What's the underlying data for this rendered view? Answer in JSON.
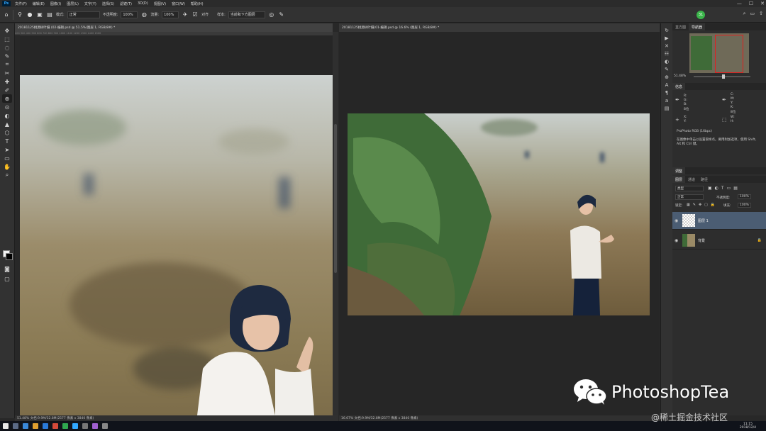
{
  "menubar": {
    "logo": "Ps",
    "items": [
      "文件(F)",
      "编辑(E)",
      "图像(I)",
      "图层(L)",
      "文字(Y)",
      "选择(S)",
      "滤镜(T)",
      "3D(D)",
      "视图(V)",
      "窗口(W)",
      "帮助(H)"
    ],
    "window_controls": [
      "—",
      "☐",
      "✕"
    ]
  },
  "options": {
    "mode_label": "模式:",
    "mode_value": "正常",
    "opacity_label": "不透明度:",
    "opacity_value": "100%",
    "flow_label": "流量:",
    "flow_value": "100%",
    "align_label": "对齐",
    "sample_label": "样本:",
    "sample_value": "当前和下方图层",
    "avatar": "31"
  },
  "tools": [
    "✥",
    "⬚",
    "◌",
    "✎",
    "⌗",
    "✂",
    "✚",
    "✐",
    "⊕",
    "⊙",
    "◐",
    "▲",
    "⬡",
    "T",
    "➤",
    "▭",
    "✋",
    "⌕"
  ],
  "doc_left": {
    "tab": "20181125桃源树叶摄 (02-编辑.psd @ 51.5%(图层 1, RGB/8#) *",
    "status": "51.48%  文档:9.9M/32.8M(2577 像素 x 3840 像素)",
    "ruler": "200    300    400    500    600    700    800    900    1000    1100    1200    1300    1400    1500"
  },
  "doc_right": {
    "tab": "20181125桃源树叶摄(01-编辑.psd @ 16.6% (图层 1, RGB/8#) *",
    "status": "16.67%  文档:9.9M/32.8M(2577 像素 x 3840 像素)"
  },
  "navigator": {
    "tabs": [
      "直方图",
      "导航器"
    ],
    "zoom": "51.48%"
  },
  "info": {
    "tab": "信息",
    "rgb_labels": [
      "R:",
      "G:",
      "B:",
      "8位"
    ],
    "cmyk_labels": [
      "C:",
      "M:",
      "Y:",
      "K:",
      "8位"
    ],
    "xy_labels": [
      "X:",
      "Y:"
    ],
    "wh_labels": [
      "W:",
      "H:"
    ],
    "profile": "ProPhoto RGB (16bpc)",
    "hint": "在图像中单击以设置取样点。要用附加选项，使用 Shift、Alt 和 Ctrl 键。"
  },
  "layers": {
    "tabs": [
      "图层",
      "通道",
      "路径"
    ],
    "filter_label": "类型",
    "blend_mode": "正常",
    "opacity_label": "不透明度:",
    "opacity_value": "100%",
    "lock_label": "锁定:",
    "fill_label": "填充:",
    "fill_value": "100%",
    "rows": [
      {
        "name": "图层 1",
        "selected": true
      },
      {
        "name": "背景",
        "selected": false
      }
    ]
  },
  "adjust_tab": "调整",
  "taskbar": {
    "time": "11:15",
    "date": "2018/12/4"
  },
  "watermark": {
    "text": "PhotoshopTea",
    "site": "@稀土掘金技术社区"
  }
}
